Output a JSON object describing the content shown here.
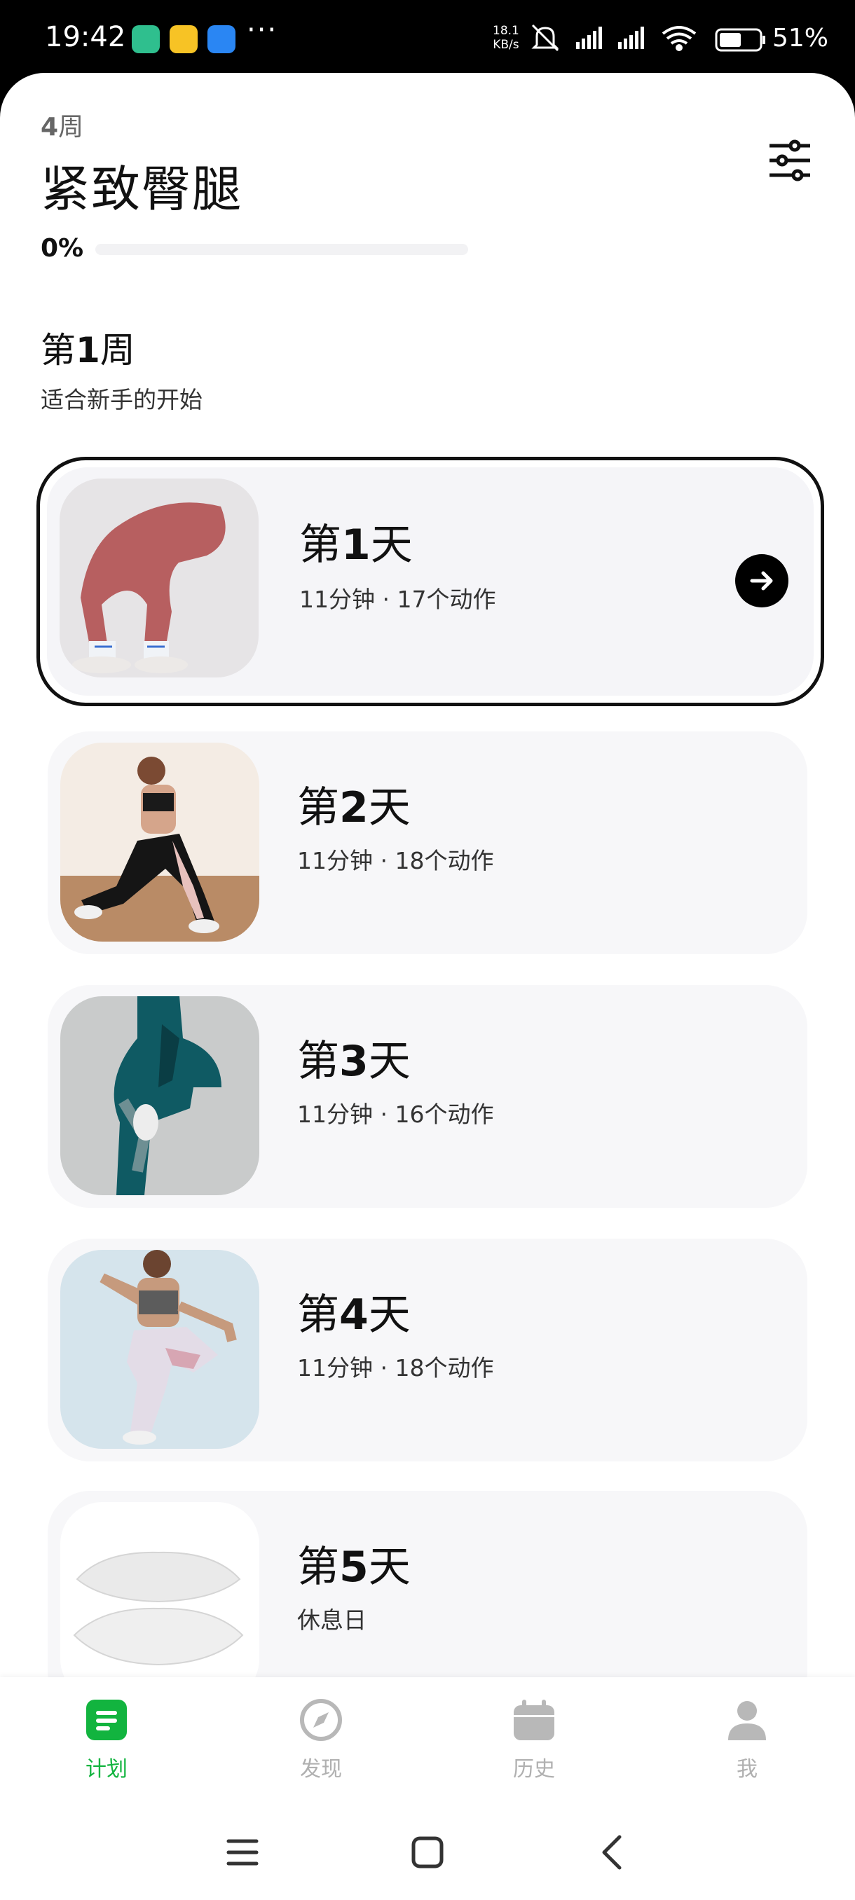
{
  "status_bar": {
    "time": "19:42",
    "more": "···",
    "net_speed_value": "18.1",
    "net_speed_unit": "KB/s",
    "battery": "51%"
  },
  "plan": {
    "duration_num": "4",
    "duration_unit": "周",
    "title": "紧致臀腿",
    "progress_percent": "0%",
    "progress_value": 0
  },
  "week": {
    "prefix": "第",
    "num": "1",
    "suffix": "周",
    "subtitle": "适合新手的开始"
  },
  "days": [
    {
      "prefix": "第",
      "num": "1",
      "suffix": "天",
      "meta": "11分钟 · 17个动作",
      "active": true
    },
    {
      "prefix": "第",
      "num": "2",
      "suffix": "天",
      "meta": "11分钟 · 18个动作",
      "active": false
    },
    {
      "prefix": "第",
      "num": "3",
      "suffix": "天",
      "meta": "11分钟 · 16个动作",
      "active": false
    },
    {
      "prefix": "第",
      "num": "4",
      "suffix": "天",
      "meta": "11分钟 · 18个动作",
      "active": false
    },
    {
      "prefix": "第",
      "num": "5",
      "suffix": "天",
      "meta": "休息日",
      "active": false
    }
  ],
  "nav": {
    "plan": "计划",
    "discover": "发现",
    "history": "历史",
    "me": "我"
  },
  "colors": {
    "accent": "#12b43f",
    "card_bg": "#f7f7f9",
    "text": "#111111"
  }
}
